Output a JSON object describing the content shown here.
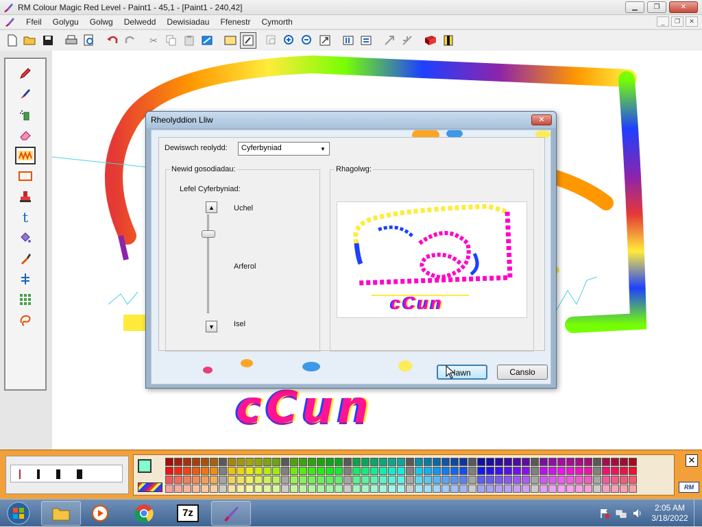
{
  "window": {
    "title": "RM Colour Magic  Red Level  - Paint1 - 45,1 - [Paint1 - 240,42]",
    "minimize": "▁",
    "maximize": "❐",
    "close": "✕"
  },
  "menubar": {
    "items": [
      "Ffeil",
      "Golygu",
      "Golwg",
      "Delwedd",
      "Dewisiadau",
      "Ffenestr",
      "Cymorth"
    ],
    "mdi_minimize": "_",
    "mdi_restore": "❐",
    "mdi_close": "✕"
  },
  "toolbar": {
    "buttons": [
      "new-file",
      "open-folder",
      "save",
      "print",
      "print-preview",
      "undo",
      "redo",
      "cut",
      "copy",
      "paste",
      "flip",
      "rectangle-select",
      "freeform-select",
      "zoom-window",
      "zoom-in",
      "zoom-out",
      "zoom-fit",
      "align-left",
      "align-center",
      "arrow-align",
      "arrow-align-2",
      "book",
      "stamp"
    ]
  },
  "tools": [
    "pencil",
    "brush",
    "spray",
    "eraser",
    "pattern-brush",
    "rectangle",
    "stamp",
    "text",
    "fill",
    "eyedropper",
    "move",
    "grid",
    "lasso"
  ],
  "dialog": {
    "title": "Rheolyddion Lliw",
    "close": "✕",
    "choose_label": "Dewiswch reolydd:",
    "choose_value": "Cyferbyniad",
    "settings_label": "Newid gosodiadau:",
    "level_label": "Lefel Cyferbyniad:",
    "high": "Uchel",
    "normal": "Arferol",
    "low": "Isel",
    "preview_label": "Rhagolwg:",
    "preview_text": "cCun",
    "ok": "Iawn",
    "cancel": "Canslo",
    "slider_level": 0.2
  },
  "canvas": {
    "text": "cCun"
  },
  "palette_strip": {
    "close": "✕",
    "logo": "RM"
  },
  "taskbar": {
    "apps": [
      "windows-explorer",
      "media-player",
      "chrome",
      "7-zip",
      "rm-colour-magic"
    ],
    "time": "2:05 AM",
    "date": "3/18/2022"
  },
  "colors": {
    "palette_strip": "#f2a13a",
    "dialog_frame": "#9fb5cc",
    "taskbar": "#3f6492"
  }
}
